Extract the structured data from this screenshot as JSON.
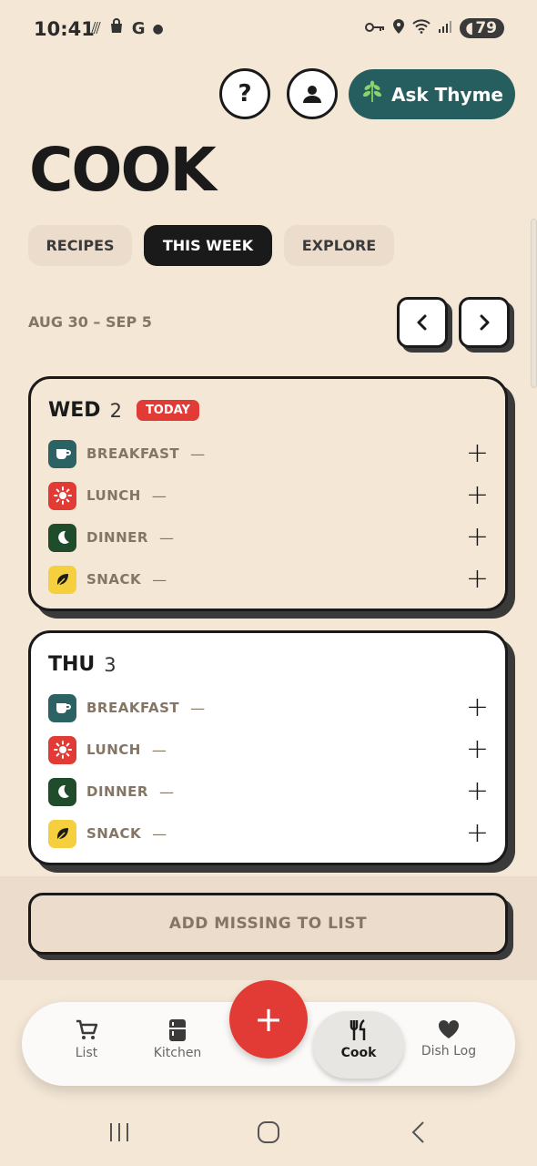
{
  "status_bar": {
    "time": "10:41",
    "left_icons": [
      "wifi-off-icon",
      "shopping-bag-icon",
      "google-icon",
      "dot-icon"
    ],
    "battery": "79"
  },
  "header": {
    "help_label": "?",
    "ask_label": "Ask Thyme",
    "title": "COOK"
  },
  "tabs": [
    {
      "label": "RECIPES",
      "active": false
    },
    {
      "label": "THIS WEEK",
      "active": true
    },
    {
      "label": "EXPLORE",
      "active": false
    }
  ],
  "week": {
    "range": "AUG 30 – SEP 5"
  },
  "days": [
    {
      "name": "WED",
      "num": "2",
      "badge": "TODAY",
      "meals": [
        {
          "label": "BREAKFAST",
          "value": "—",
          "color": "#2b6364"
        },
        {
          "label": "LUNCH",
          "value": "—",
          "color": "#e23a34"
        },
        {
          "label": "DINNER",
          "value": "—",
          "color": "#1f4d2c"
        },
        {
          "label": "SNACK",
          "value": "—",
          "color": "#f5cf3d"
        }
      ]
    },
    {
      "name": "THU",
      "num": "3",
      "badge": "",
      "meals": [
        {
          "label": "BREAKFAST",
          "value": "—",
          "color": "#2b6364"
        },
        {
          "label": "LUNCH",
          "value": "—",
          "color": "#e23a34"
        },
        {
          "label": "DINNER",
          "value": "—",
          "color": "#1f4d2c"
        },
        {
          "label": "SNACK",
          "value": "—",
          "color": "#f5cf3d"
        }
      ]
    }
  ],
  "add_missing_label": "ADD MISSING TO LIST",
  "bottom_nav": {
    "list": "List",
    "kitchen": "Kitchen",
    "cook": "Cook",
    "dish_log": "Dish Log",
    "fab": "+"
  },
  "colors": {
    "background": "#f4e7d6",
    "accent": "#265d5f",
    "danger": "#e23a34"
  }
}
